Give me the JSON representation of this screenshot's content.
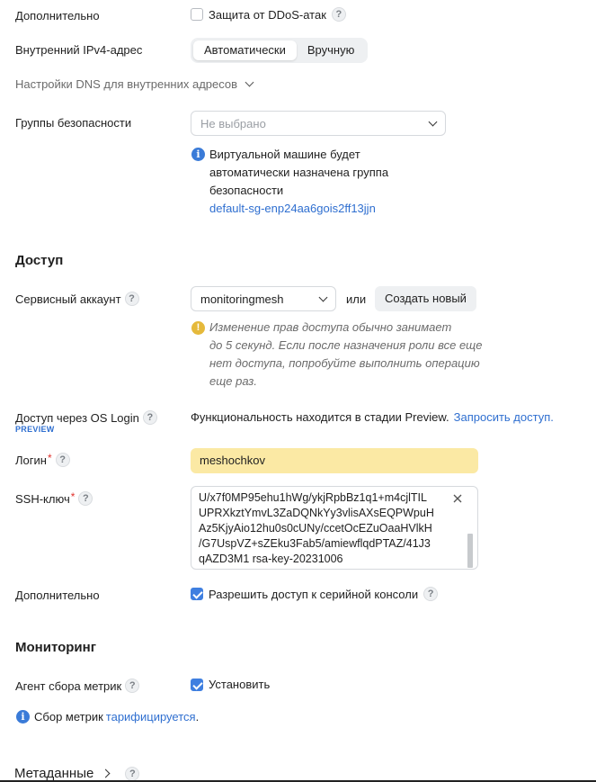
{
  "extra": {
    "label": "Дополнительно",
    "ddos_label": "Защита от DDoS-атак",
    "ddos_checked": false
  },
  "ipv4": {
    "label": "Внутренний IPv4-адрес",
    "options": [
      "Автоматически",
      "Вручную"
    ],
    "selected": "Автоматически"
  },
  "dns": {
    "label": "Настройки DNS для внутренних адресов"
  },
  "security_groups": {
    "label": "Группы безопасности",
    "placeholder": "Не выбрано",
    "info_lines": [
      "Виртуальной машине будет",
      "автоматически назначена группа",
      "безопасности"
    ],
    "info_link": "default-sg-enp24aa6gois2ff13jjn"
  },
  "access": {
    "title": "Доступ",
    "service_account_label": "Сервисный аккаунт",
    "service_account_value": "monitoringmesh",
    "or_text": "или",
    "create_new_label": "Создать новый",
    "warning_lines": [
      "Изменение прав доступа обычно занимает",
      "до 5 секунд. Если после назначения роли все еще",
      "нет доступа, попробуйте выполнить операцию",
      "еще раз."
    ],
    "os_login_label": "Доступ через OS Login",
    "preview_badge": "PREVIEW",
    "os_login_text": "Функциональность находится в стадии Preview.",
    "os_login_link": "Запросить доступ.",
    "login_label": "Логин",
    "login_value": "meshochkov",
    "ssh_label": "SSH-ключ",
    "ssh_lines": [
      "U/x7f0MP95ehu1hWg/ykjRpbBz1q1+m4cjlTIL",
      "UPRXkztYmvL3ZaDQNkYy3vlisAXsEQPWpuH",
      "Az5KjyAio12hu0s0cUNy/ccetOcEZuOaaHVlkH",
      "/G7UspVZ+sZEku3Fab5/amiewflqdPTAZ/41J3",
      "qAZD3M1 rsa-key-20231006"
    ],
    "extra_label": "Дополнительно",
    "serial_console_label": "Разрешить доступ к серийной консоли",
    "serial_console_checked": true
  },
  "monitoring": {
    "title": "Мониторинг",
    "agent_label": "Агент сбора метрик",
    "install_label": "Установить",
    "install_checked": true,
    "info_text": "Сбор метрик",
    "info_link": "тарифицируется",
    "info_suffix": "."
  },
  "metadata": {
    "title": "Метаданные"
  },
  "colors": {
    "accent": "#3f7fe0",
    "link": "#2f6fd0",
    "login_field_bg": "#fbe9a4",
    "warning": "#e5b93b",
    "required": "#e0312c"
  }
}
